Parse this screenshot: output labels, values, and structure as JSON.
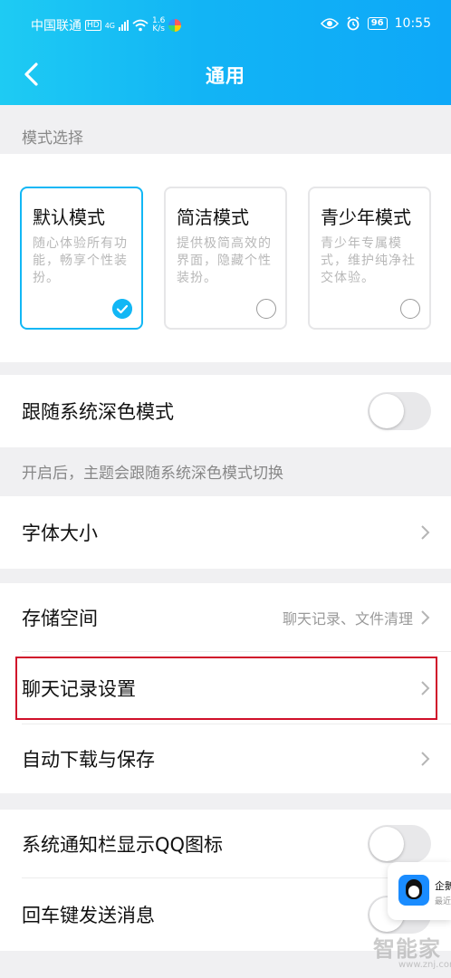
{
  "status_bar": {
    "carrier": "中国联通",
    "hd": "HD",
    "signal": "4G",
    "speed_value": "1.6",
    "speed_unit": "K/s",
    "battery": "96",
    "time": "10:55"
  },
  "nav": {
    "title": "通用",
    "back_icon": "chevron-left-icon"
  },
  "mode_section": {
    "label": "模式选择",
    "modes": [
      {
        "title": "默认模式",
        "desc": "随心体验所有功能，畅享个性装扮。",
        "selected": true
      },
      {
        "title": "简洁模式",
        "desc": "提供极简高效的界面，隐藏个性装扮。",
        "selected": false
      },
      {
        "title": "青少年模式",
        "desc": "青少年专属模式，维护纯净社交体验。",
        "selected": false
      }
    ]
  },
  "dark_mode": {
    "label": "跟随系统深色模式",
    "on": false,
    "hint": "开启后，主题会跟随系统深色模式切换"
  },
  "font_size": {
    "label": "字体大小"
  },
  "storage": {
    "label": "存储空间",
    "value": "聊天记录、文件清理"
  },
  "chat_history": {
    "label": "聊天记录设置"
  },
  "auto_download": {
    "label": "自动下载与保存"
  },
  "notify_icon": {
    "label": "系统通知栏显示QQ图标",
    "on": false
  },
  "enter_send": {
    "label": "回车键发送消息",
    "on": false
  },
  "float_widget": {
    "title": "企鹅",
    "subtitle": "最近"
  },
  "watermark": {
    "text": "智能家",
    "sub": "www.znj.com"
  },
  "colors": {
    "accent": "#12b7f5",
    "highlight": "#d0102a"
  }
}
